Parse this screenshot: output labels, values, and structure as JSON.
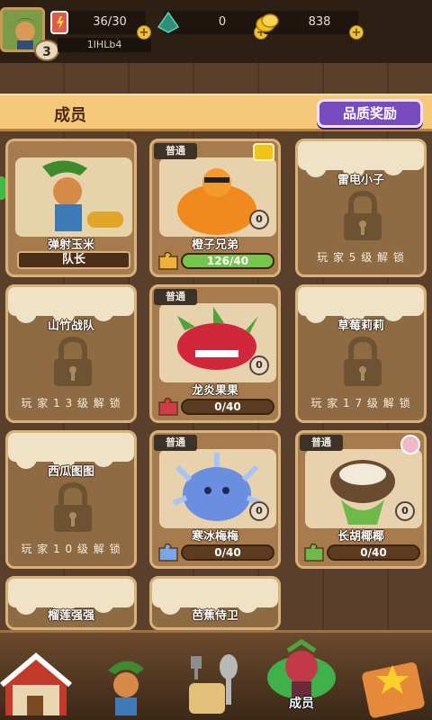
{
  "topbar": {
    "energy": "36/30",
    "gems": "0",
    "coins": "838",
    "level": "3",
    "player_id": "1IHLb4"
  },
  "header": {
    "title": "成员",
    "quality_reward": "品质奖励"
  },
  "cards": [
    {
      "name": "弹射玉米",
      "captain": "队长"
    },
    {
      "tag": "普通",
      "name": "橙子兄弟",
      "count": "0",
      "progress": "126/40",
      "fill": 1.0
    },
    {
      "name": "雷电小子",
      "unlock": "玩 家 5 级 解 锁"
    },
    {
      "name": "山竹战队",
      "unlock": "玩 家 1 3 级 解 锁"
    },
    {
      "tag": "普通",
      "name": "龙炎果果",
      "count": "0",
      "progress": "0/40",
      "fill": 0
    },
    {
      "name": "草莓莉莉",
      "unlock": "玩 家 1 7 级 解 锁"
    },
    {
      "name": "西瓜图图",
      "unlock": "玩 家 1 0 级 解 锁"
    },
    {
      "tag": "普通",
      "name": "寒冰梅梅",
      "count": "0",
      "progress": "0/40",
      "fill": 0
    },
    {
      "tag": "普通",
      "name": "长胡椰椰",
      "count": "0",
      "progress": "0/40",
      "fill": 0
    },
    {
      "name": "榴莲强强"
    },
    {
      "name": "芭蕉侍卫"
    }
  ],
  "nav": {
    "members_label": "成员"
  },
  "colors": {
    "accent_purple": "#7a4bbf",
    "progress_green": "#74c64c",
    "header_bg": "#f6c97a"
  }
}
